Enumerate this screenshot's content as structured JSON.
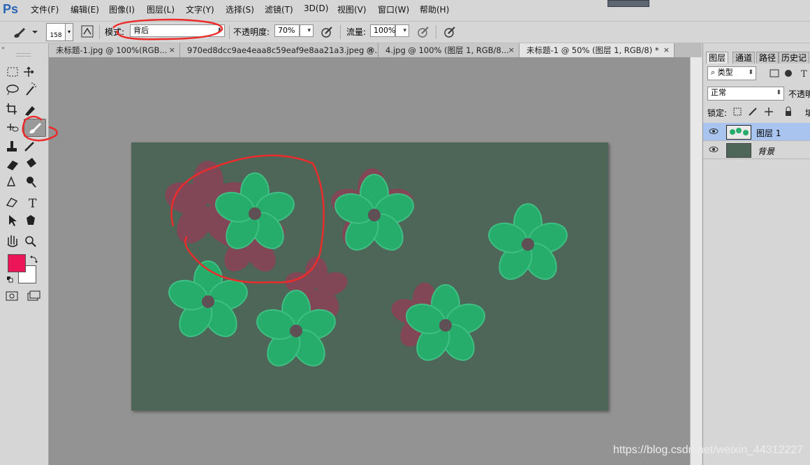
{
  "app": {
    "logo": "Ps"
  },
  "menu": {
    "items": [
      "文件(F)",
      "编辑(E)",
      "图像(I)",
      "图层(L)",
      "文字(Y)",
      "选择(S)",
      "滤镜(T)",
      "3D(D)",
      "视图(V)",
      "窗口(W)",
      "帮助(H)"
    ]
  },
  "options": {
    "brush_size": "158",
    "mode_label": "模式:",
    "mode_value": "背后",
    "opacity_label": "不透明度:",
    "opacity_value": "70%",
    "flow_label": "流量:",
    "flow_value": "100%"
  },
  "tabs": [
    {
      "label": "未标题-1.jpg @ 100%(RGB..."
    },
    {
      "label": "970ed8dcc9ae4eaa8c59eaf9e8aa21a3.jpeg @..."
    },
    {
      "label": "4.jpg @ 100% (图层 1, RGB/8..."
    },
    {
      "label": "未标题-1 @ 50% (图层 1, RGB/8) *"
    }
  ],
  "tab_close": "×",
  "colors": {
    "foreground": "#ec1557",
    "background": "#ffffff",
    "canvas_bg": "#4d6658",
    "flower_green": "#27ad6b",
    "flower_red": "#8c4257",
    "annotation": "#ec2b2b"
  },
  "panel": {
    "tabs": [
      "图层",
      "通道",
      "路径",
      "历史记"
    ],
    "filter_label": "类型",
    "filter_search_icon": "search-icon",
    "blend_mode": "正常",
    "opacity_label": "不透明",
    "lock_label": "锁定:",
    "fill_label": "填",
    "layers": [
      {
        "name": "图层 1",
        "selected": true
      },
      {
        "name": "背景",
        "selected": false,
        "italic": true
      }
    ]
  },
  "watermark": "https://blog.csdn.net/weixin_44312227"
}
